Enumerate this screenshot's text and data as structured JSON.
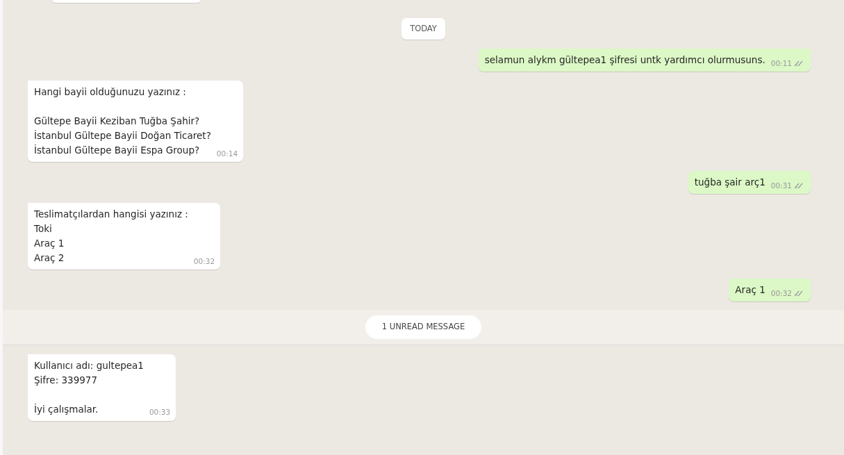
{
  "timeline": [
    {
      "kind": "fragment"
    },
    {
      "kind": "date",
      "label": "TODAY"
    },
    {
      "kind": "outgoing",
      "text": "selamun alykm gültepea1 şifresi untk yardımcı olurmusuns.",
      "time": "00:11",
      "delivered": true
    },
    {
      "kind": "incoming",
      "text": "Hangi bayii olduğunuzu yazınız :\n\nGültepe Bayii Keziban Tuğba Şahir?\nİstanbul Gültepe Bayii Doğan Ticaret?\nİstanbul Gültepe Bayii Espa Group?",
      "time": "00:14"
    },
    {
      "kind": "outgoing",
      "text": "tuğba şair arç1",
      "time": "00:31",
      "delivered": true
    },
    {
      "kind": "incoming",
      "text": "Teslimatçılardan hangisi yazınız :\nToki\nAraç 1\nAraç 2",
      "time": "00:32"
    },
    {
      "kind": "outgoing",
      "text": "Araç 1",
      "time": "00:32",
      "delivered": true
    },
    {
      "kind": "unread",
      "label": "1 UNREAD MESSAGE"
    },
    {
      "kind": "incoming",
      "text": "Kullanıcı adı: gultepea1\nŞifre: 339977\n\nİyi çalışmalar.",
      "time": "00:33"
    }
  ]
}
